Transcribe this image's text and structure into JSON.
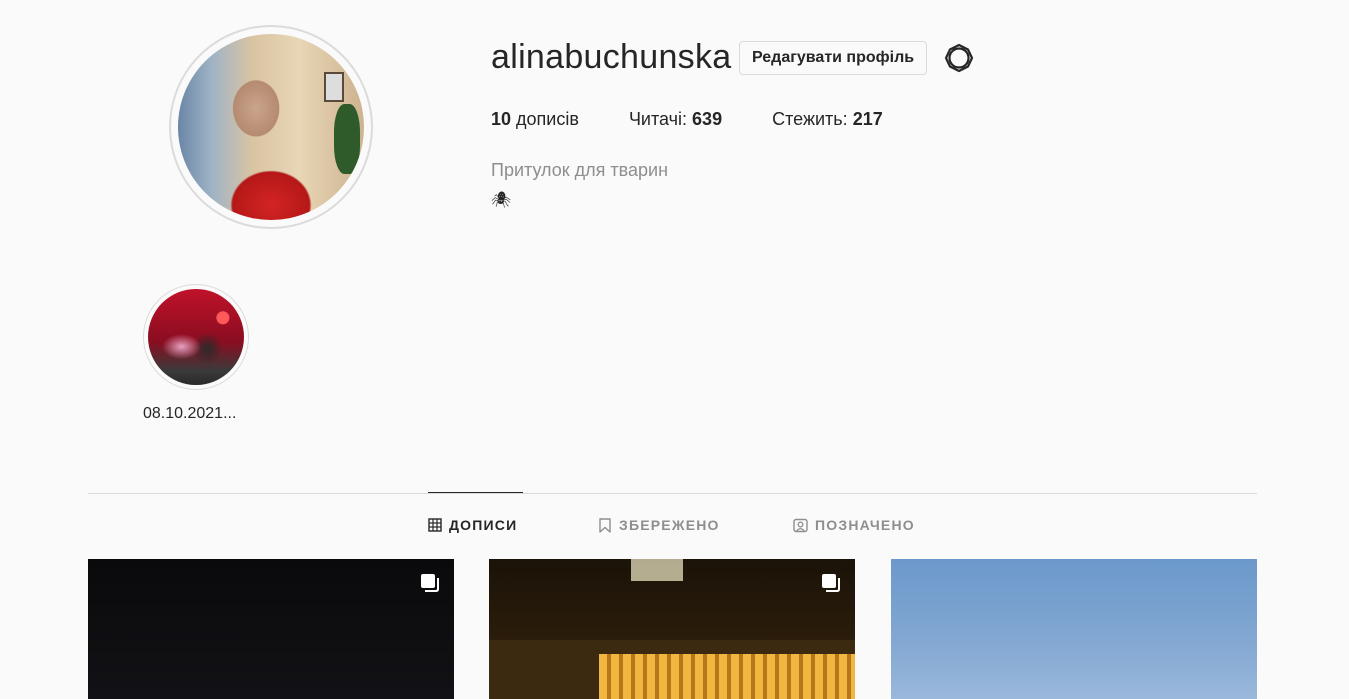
{
  "profile": {
    "username": "alinabuchunska",
    "edit_button_label": "Редагувати профіль",
    "settings_icon": "gear-icon",
    "stats": {
      "posts_count": "10",
      "posts_label": "дописів",
      "followers_label": "Читачі:",
      "followers_count": "639",
      "following_label": "Стежить:",
      "following_count": "217"
    },
    "bio_name": "Притулок для тварин",
    "bio_emoji": "🕷"
  },
  "highlights": [
    {
      "label": "08.10.2021..."
    }
  ],
  "tabs": [
    {
      "label": "ДОПИСИ",
      "icon": "grid-icon",
      "active": true
    },
    {
      "label": "ЗБЕРЕЖЕНО",
      "icon": "bookmark-icon",
      "active": false
    },
    {
      "label": "ПОЗНАЧЕНО",
      "icon": "tagged-icon",
      "active": false
    }
  ],
  "posts": [
    {
      "multi": true
    },
    {
      "multi": true
    },
    {
      "multi": false
    }
  ]
}
